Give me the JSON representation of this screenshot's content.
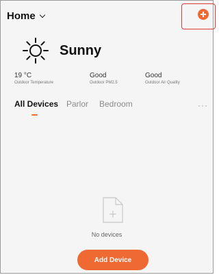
{
  "header": {
    "home_label": "Home"
  },
  "weather": {
    "condition": "Sunny",
    "stats": [
      {
        "value": "19 °C",
        "label": "Outdoor Temperature"
      },
      {
        "value": "Good",
        "label": "Outdoor PM2.5"
      },
      {
        "value": "Good",
        "label": "Outdoor Air Quality"
      }
    ]
  },
  "tabs": [
    {
      "label": "All Devices",
      "active": true
    },
    {
      "label": "Parlor",
      "active": false
    },
    {
      "label": "Bedroom",
      "active": false
    }
  ],
  "more_label": "···",
  "empty_state": {
    "message": "No devices",
    "button_label": "Add Device"
  },
  "colors": {
    "accent": "#ef6a33",
    "highlight": "#d63a3a"
  }
}
